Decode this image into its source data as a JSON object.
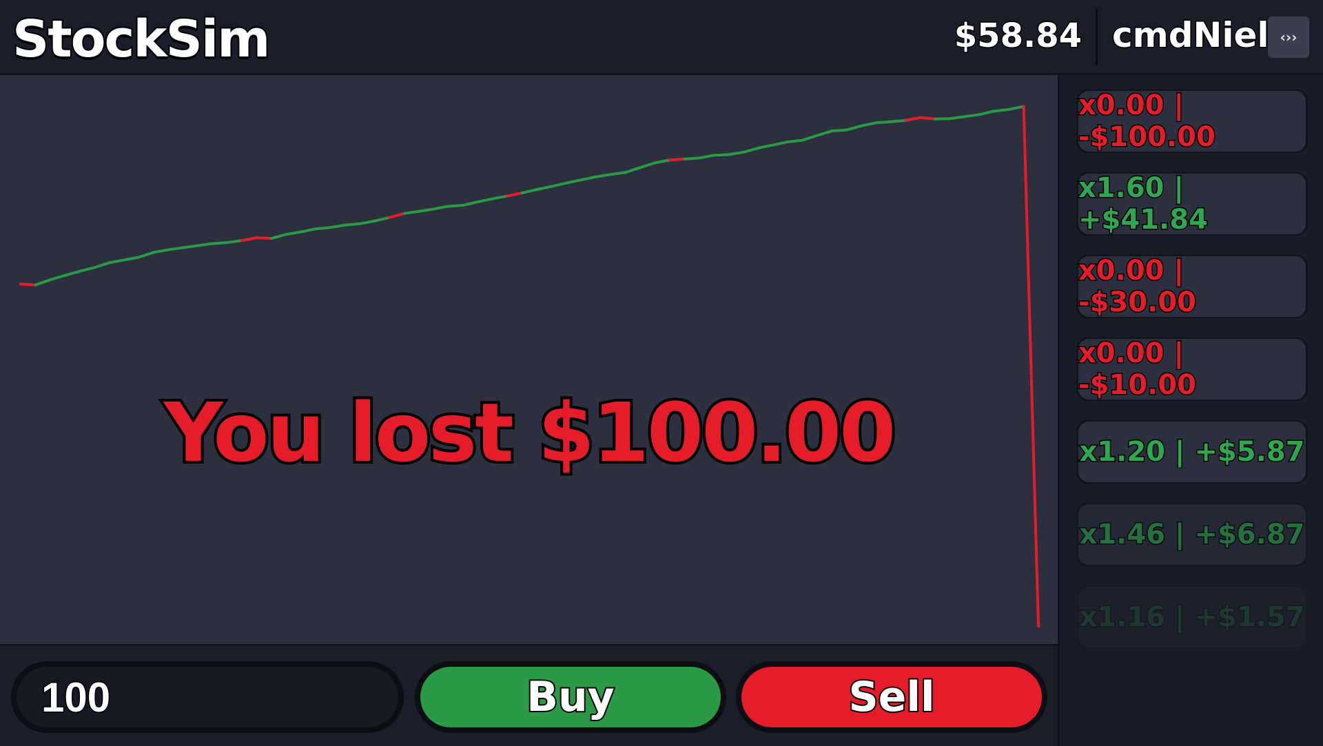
{
  "app": {
    "title": "StockSim"
  },
  "header": {
    "balance": "$58.84",
    "username": "cmdNiels",
    "menu_icon": "‹››"
  },
  "colors": {
    "gain": "#2a9a47",
    "loss": "#e51d2a",
    "text_gain": "#2fa64f",
    "text_loss": "#e51d2a"
  },
  "result": {
    "message": "You lost $100.00"
  },
  "controls": {
    "amount_value": "100",
    "buy_label": "Buy",
    "sell_label": "Sell"
  },
  "history": [
    {
      "text": "x0.00 | -$100.00",
      "outcome": "loss"
    },
    {
      "text": "x1.60 | +$41.84",
      "outcome": "gain"
    },
    {
      "text": "x0.00 | -$30.00",
      "outcome": "loss"
    },
    {
      "text": "x0.00 | -$10.00",
      "outcome": "loss"
    },
    {
      "text": "x1.20 | +$5.87",
      "outcome": "gain"
    },
    {
      "text": "x1.46 | +$6.87",
      "outcome": "gain"
    },
    {
      "text": "x1.16 | +$1.57",
      "outcome": "gain"
    }
  ],
  "chart_data": {
    "type": "line",
    "series": [
      {
        "values": [
          0.0,
          -0.3,
          1.2,
          2.5,
          3.7,
          4.8,
          6.2,
          7.0,
          7.8,
          9.2,
          10.0,
          10.6,
          11.2,
          11.8,
          12.1,
          12.7,
          13.5,
          13.3,
          14.5,
          15.2,
          16.1,
          16.5,
          17.2,
          17.6,
          18.4,
          19.4,
          20.6,
          21.2,
          21.9,
          22.7,
          23.0,
          24.0,
          24.9,
          25.7,
          26.6,
          27.6,
          28.5,
          29.5,
          30.4,
          31.3,
          32.0,
          32.6,
          34.0,
          35.4,
          36.2,
          36.5,
          36.8,
          37.6,
          37.8,
          38.5,
          39.7,
          40.6,
          41.5,
          42.0,
          43.4,
          44.7,
          45.0,
          46.2,
          47.1,
          47.4,
          47.8,
          48.6,
          48.2,
          48.3,
          48.9,
          49.5,
          50.5,
          51.0,
          51.9,
          -100.0
        ],
        "loss_steps": [
          16,
          26,
          34,
          45,
          61,
          62
        ]
      }
    ],
    "ylim": [
      -100,
      55
    ],
    "grid": false,
    "legend": "none"
  }
}
